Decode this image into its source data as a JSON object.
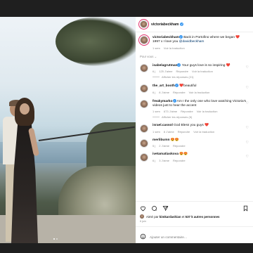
{
  "post": {
    "username": "victoriabeckham",
    "caption_user": "victoriabeckham",
    "caption_text": " Back in Portofino where we began ❤️ 1997 x I love you ",
    "caption_mention": "@davidbeckham",
    "caption_time": "1 sem",
    "translate_label": "Voir la traduction"
  },
  "pour_vous": "Pour vous ⌄",
  "comments": [
    {
      "user": "isabelagrutman",
      "text": " Your guys love is so inspiring ❤️",
      "time": "6 j",
      "likes": "125 J'aime",
      "reply": "Répondre",
      "translate": "Voir la traduction",
      "replies": "Afficher les réponses (21)"
    },
    {
      "user": "the_art_booth",
      "text": " ❤️beautiful",
      "time": "6 j",
      "likes": "8 J'aime",
      "reply": "Répondre",
      "translate": "Voir la traduction",
      "replies": ""
    },
    {
      "user": "freakymarko",
      "text": " Am I the only one who love watching Victoria's videos just to hear the accent",
      "time": "1 sem",
      "likes": "673 J'aime",
      "reply": "Répondre",
      "translate": "Voir la traduction",
      "replies": "Afficher les réponses (6)"
    },
    {
      "user": "israel.cassol",
      "text": " God Bless you guys ❤️",
      "time": "1 sem",
      "likes": "8 J'aime",
      "reply": "Répondre",
      "translate": "Voir la traduction",
      "replies": ""
    },
    {
      "user": "merlibumn",
      "text": " 😍😍",
      "time": "5 j",
      "likes": "2 J'aime",
      "reply": "Répondre",
      "translate": "",
      "replies": ""
    },
    {
      "user": "ivetamatiaskova",
      "text": " 😍😍",
      "time": "6 j",
      "likes": "3 J'aime",
      "reply": "Répondre",
      "translate": "",
      "replies": ""
    }
  ],
  "liked_by": {
    "prefix": "Aimé par ",
    "user": "kimkardashian",
    "middle": " et ",
    "others": "537 k autres personnes"
  },
  "date": "6 juin",
  "add_comment_placeholder": "Ajouter un commentaire…",
  "colors": {
    "verified": "#3897f0",
    "mention": "#00376b",
    "heart": "#ed4956"
  },
  "icons": [
    "heart-icon",
    "comment-icon",
    "share-icon",
    "bookmark-icon",
    "emoji-icon",
    "more-icon"
  ]
}
